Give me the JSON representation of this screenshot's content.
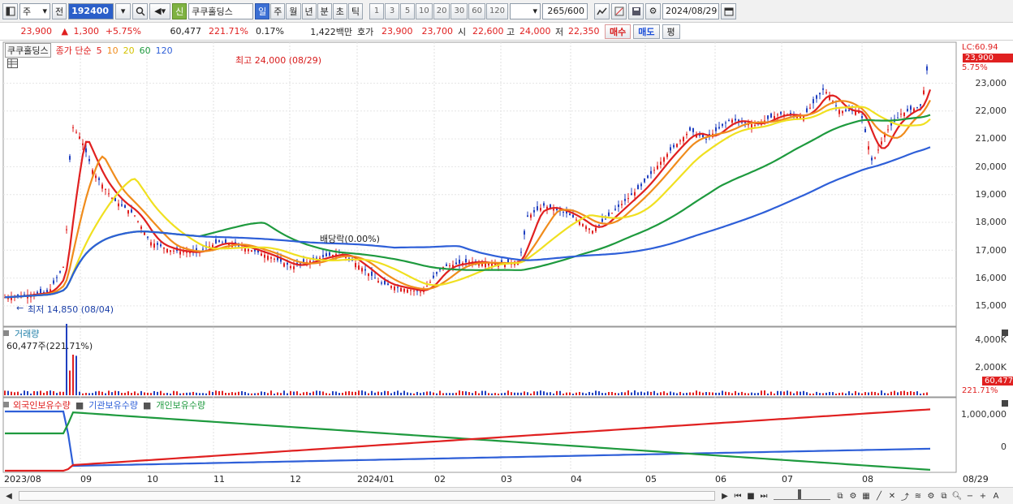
{
  "toolbar": {
    "market": "주",
    "all_label": "전",
    "code": "192400",
    "new_badge": "신",
    "stock_name": "쿠쿠홀딩스",
    "period_tabs": [
      "일",
      "주",
      "월",
      "년",
      "분",
      "초",
      "틱"
    ],
    "active_tab": "일",
    "intervals": [
      "1",
      "3",
      "5",
      "10",
      "20",
      "30",
      "60",
      "120"
    ],
    "count": "265/600",
    "date": "2024/08/29"
  },
  "quote": {
    "price": "23,900",
    "change_arrow": "▲",
    "change": "1,300",
    "change_pct": "+5.75%",
    "volume": "60,477",
    "volume_ratio": "221.71%",
    "turnover": "0.17%",
    "amount": "1,422백만",
    "hoga_label": "호가",
    "ask": "23,900",
    "bid": "23,700",
    "open_label": "시",
    "open": "22,600",
    "high_label": "고",
    "high": "24,000",
    "low_label": "저",
    "low": "22,350",
    "buy_label": "매수",
    "sell_label": "매도",
    "eval_label": "평"
  },
  "price_panel": {
    "legend_name": "쿠쿠홀딩스",
    "legend_text": "종가 단순",
    "ma_periods": [
      "5",
      "10",
      "20",
      "60",
      "120"
    ],
    "ma_colors": [
      "#e02020",
      "#f08c1c",
      "#f0e020",
      "#1e9a3e",
      "#2e5fd8"
    ],
    "lc_label": "LC:60.94",
    "last_price": "23,900",
    "last_pct": "5.75%",
    "high_note": "최고 24,000 (08/29)",
    "low_note": "최저 14,850 (08/04)",
    "dividend_note": "배당락(0.00%)",
    "y_ticks": [
      "23,000",
      "22,000",
      "21,000",
      "20,000",
      "19,000",
      "18,000",
      "17,000",
      "16,000",
      "15,000"
    ]
  },
  "volume_panel": {
    "title": "거래량",
    "value_note": "60,477주(221.71%)",
    "y_ticks": [
      "4,000K",
      "2,000K"
    ],
    "last_volume": "60,477",
    "last_ratio": "221.71%"
  },
  "holdings_panel": {
    "series": [
      "외국인보유수량",
      "기관보유수량",
      "개인보유수량"
    ],
    "colors": [
      "#e02020",
      "#1e9a3e",
      "#2e5fd8"
    ],
    "y_ticks": [
      "1,000,000",
      "0"
    ]
  },
  "x_axis": {
    "labels": [
      "2023/08",
      "09",
      "10",
      "11",
      "12",
      "2024/01",
      "02",
      "03",
      "04",
      "05",
      "06",
      "07",
      "08"
    ],
    "right_label": "08/29"
  }
}
